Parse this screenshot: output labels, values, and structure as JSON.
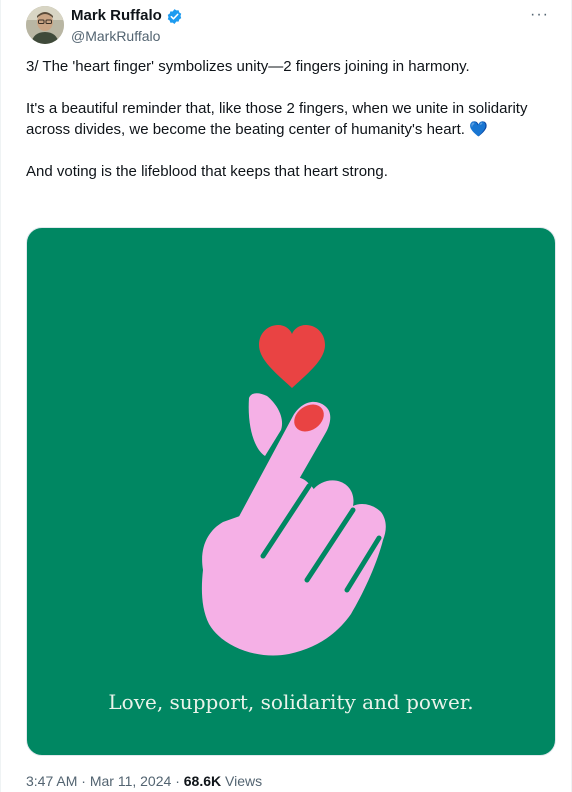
{
  "author": {
    "display_name": "Mark Ruffalo",
    "handle": "@MarkRuffalo",
    "verified_icon": "verified-badge-icon",
    "verified_color": "#1d9bf0"
  },
  "more_icon": "more-options-icon",
  "more_label": "···",
  "tweet": {
    "paragraphs": [
      "3/ The 'heart finger' symbolizes unity—2 fingers joining in harmony.",
      "It's a beautiful reminder that, like those 2 fingers, when we unite in solidarity across divides, we become the beating center of humanity's heart. 💙",
      "And voting is the lifeblood that keeps that heart strong."
    ]
  },
  "media": {
    "background_color": "#008762",
    "hand_color": "#f5b0e6",
    "heart_color": "#e94343",
    "caption": "Love, support, solidarity and power.",
    "icons": [
      "finger-heart-hand-icon",
      "red-heart-icon"
    ]
  },
  "meta": {
    "time": "3:47 AM",
    "separator": "·",
    "date": "Mar 11, 2024",
    "views_count": "68.6K",
    "views_label": "Views"
  }
}
